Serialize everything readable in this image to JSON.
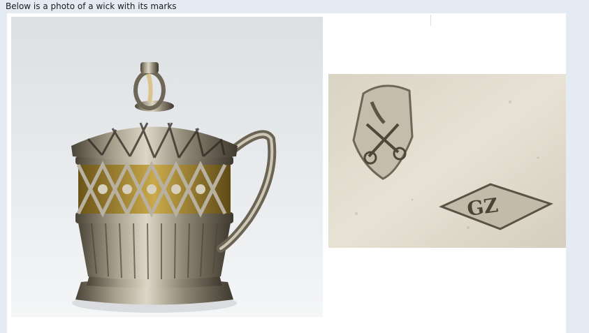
{
  "post": {
    "caption": "Below is a photo of a wick with its marks"
  },
  "images": {
    "main_photo": {
      "description": "silver wick holder",
      "icon": "photo"
    },
    "marks_photo": {
      "description": "hallmarks",
      "mark_text": "GZ",
      "icon": "photo"
    }
  }
}
